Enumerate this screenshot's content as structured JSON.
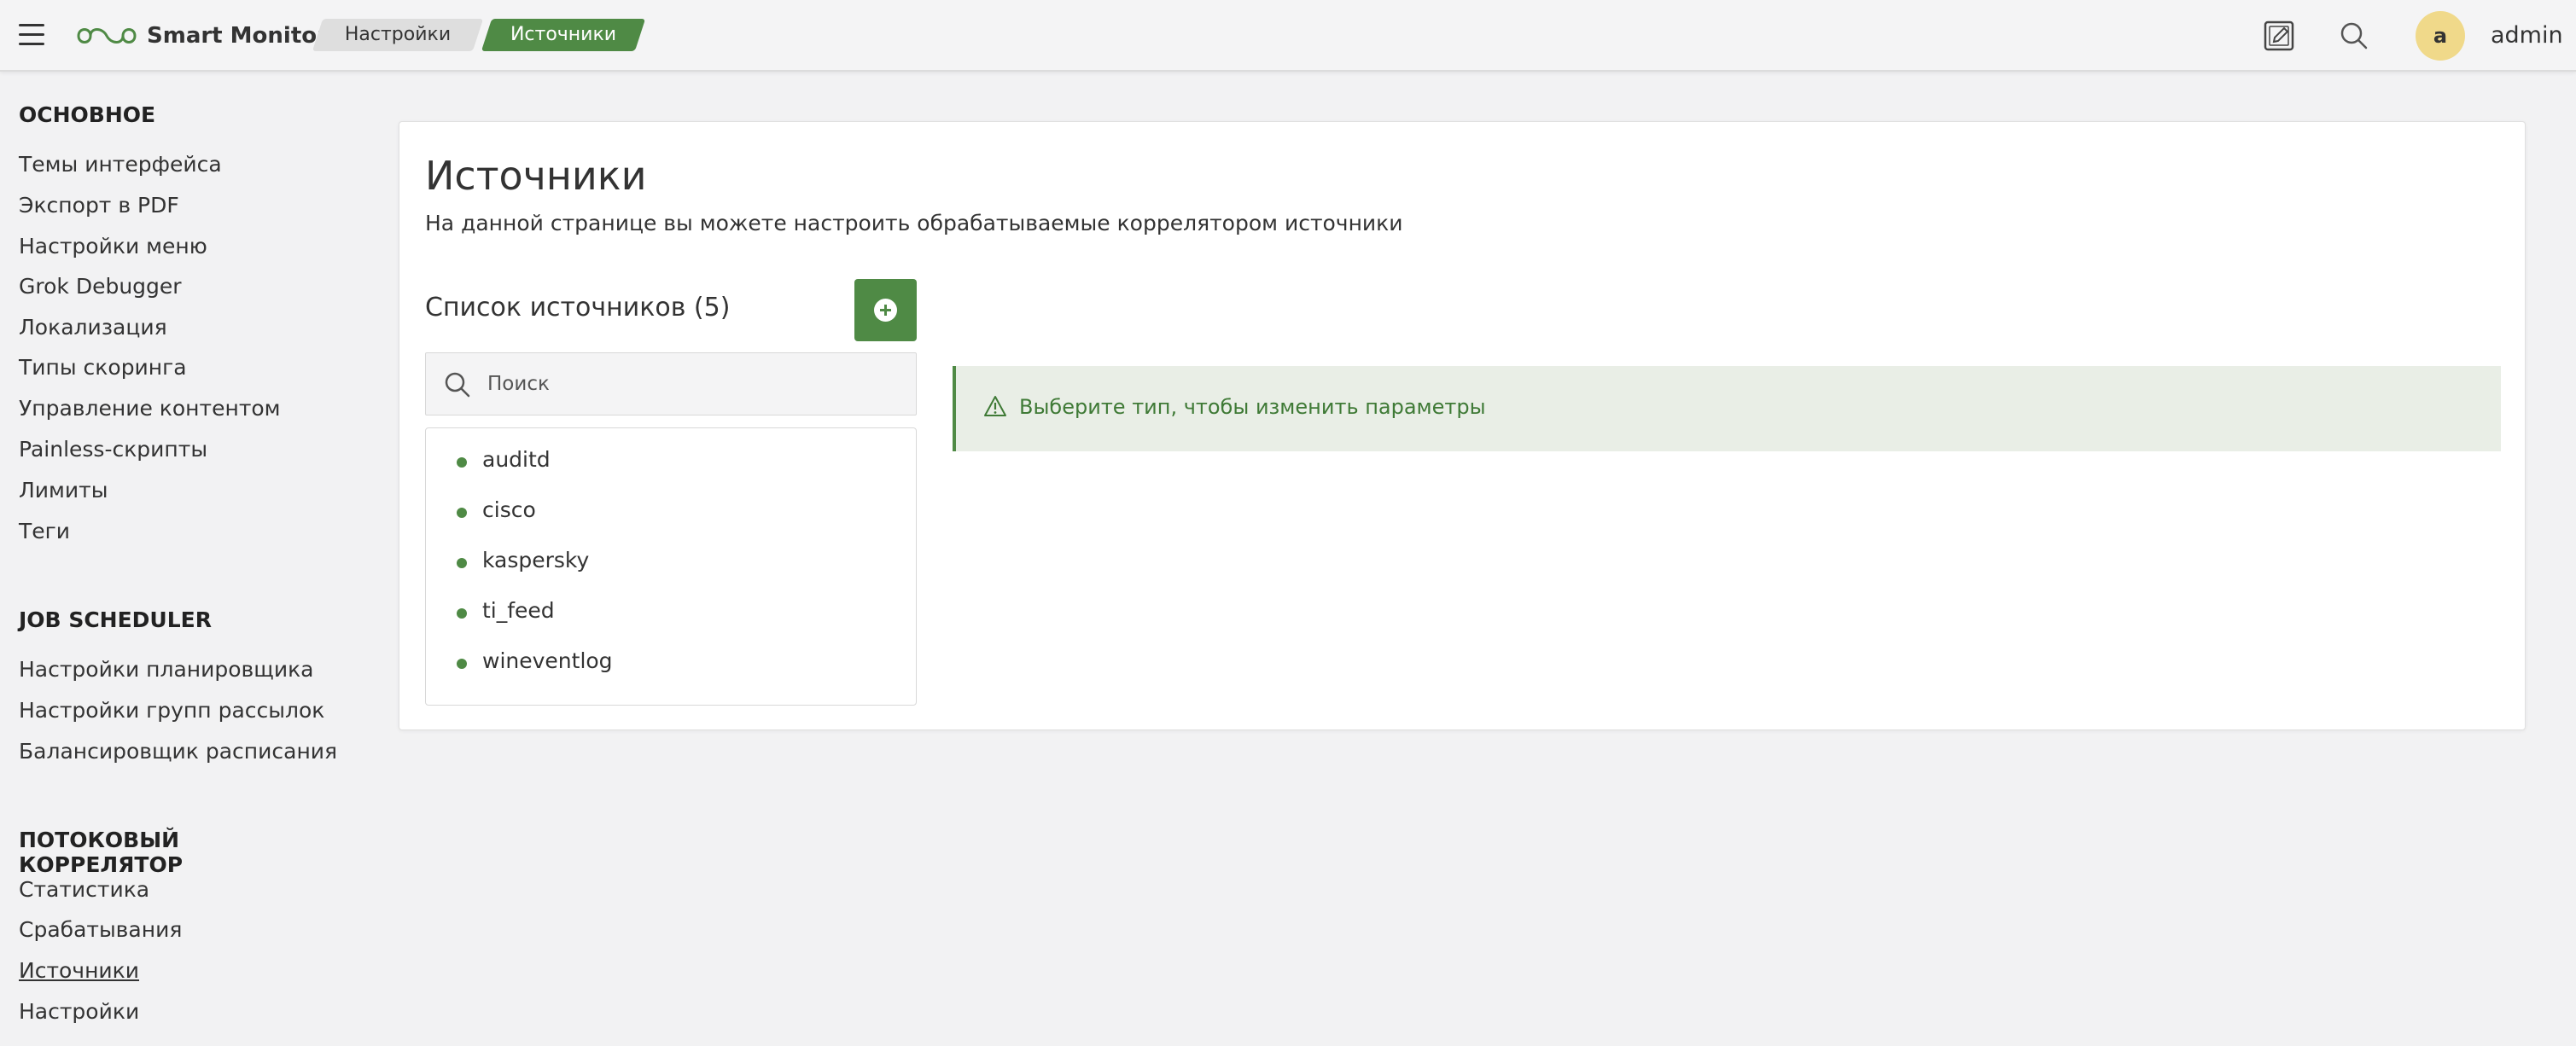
{
  "header": {
    "app_name": "Smart Monitor",
    "breadcrumbs": [
      "Настройки",
      "Источники"
    ],
    "avatar_letter": "a",
    "username": "admin",
    "icons": [
      "menu-icon",
      "logo-icon",
      "edit-icon",
      "search-icon"
    ]
  },
  "sidebar": {
    "sections": [
      {
        "title": "ОСНОВНОЕ",
        "items": [
          "Темы интерфейса",
          "Экспорт в PDF",
          "Настройки меню",
          "Grok Debugger",
          "Локализация",
          "Типы скоринга",
          "Управление контентом",
          "Painless-скрипты",
          "Лимиты",
          "Теги"
        ]
      },
      {
        "title": "JOB SCHEDULER",
        "items": [
          "Настройки планировщика",
          "Настройки групп рассылок",
          "Балансировщик расписания"
        ]
      },
      {
        "title": "ПОТОКОВЫЙ КОРРЕЛЯТОР",
        "items": [
          "Статистика",
          "Срабатывания",
          "Источники",
          "Настройки"
        ]
      }
    ],
    "active_item": "Источники"
  },
  "main": {
    "title": "Источники",
    "description": "На данной странице вы можете настроить обрабатываемые коррелятором источники",
    "list_title": "Список источников (5)",
    "search_placeholder": "Поиск",
    "sources": [
      "auditd",
      "cisco",
      "kaspersky",
      "ti_feed",
      "wineventlog"
    ],
    "alert_message": "Выберите тип, чтобы изменить параметры"
  },
  "colors": {
    "accent": "#4f8a45",
    "alert_bg": "#e9eee6",
    "avatar_bg": "#f0d98a",
    "page_bg": "#f2f2f3"
  }
}
